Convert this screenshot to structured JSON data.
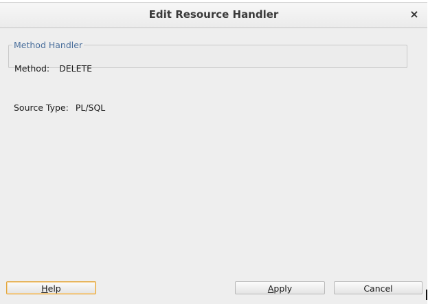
{
  "dialog": {
    "title": "Edit Resource Handler",
    "close_glyph": "×"
  },
  "method_handler": {
    "legend": "Method Handler",
    "method_label": "Method:",
    "method_value": "DELETE"
  },
  "source": {
    "label": "Source Type:",
    "value": "PL/SQL"
  },
  "buttons": {
    "help": {
      "mnemonic": "H",
      "rest": "elp"
    },
    "apply": {
      "mnemonic": "A",
      "rest": "pply"
    },
    "cancel": {
      "label": "Cancel"
    }
  },
  "colors": {
    "legend_text": "#4a6f9c",
    "focused_button_border": "#e3a53a",
    "dialog_background": "#eeeeee"
  }
}
